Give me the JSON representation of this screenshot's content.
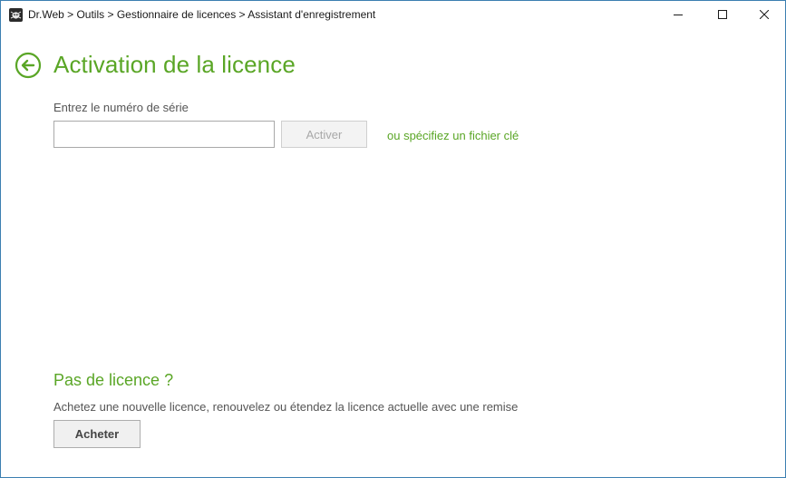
{
  "window": {
    "title": "Dr.Web > Outils > Gestionnaire de licences > Assistant d'enregistrement",
    "controls": {
      "minimize_icon": "minimize-icon",
      "maximize_icon": "maximize-icon",
      "close_icon": "close-icon"
    }
  },
  "page": {
    "title": "Activation de la licence",
    "back_icon": "back-arrow-icon"
  },
  "activation": {
    "serial_label": "Entrez le numéro de série",
    "serial_value": "",
    "activate_label": "Activer",
    "activate_enabled": false,
    "keyfile_link": "ou spécifiez un fichier clé"
  },
  "no_license": {
    "title": "Pas de licence ?",
    "description": "Achetez une nouvelle licence, renouvelez ou étendez la licence actuelle avec une remise",
    "buy_label": "Acheter"
  },
  "colors": {
    "accent_green": "#5aa626",
    "window_border": "#3c7fb1",
    "disabled_text": "#a8a8a8"
  }
}
